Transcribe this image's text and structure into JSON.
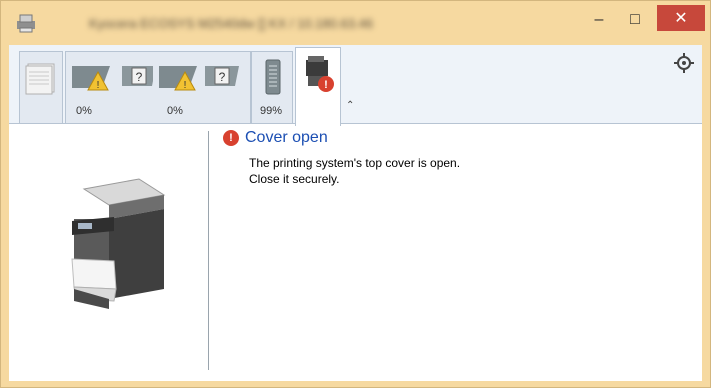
{
  "window": {
    "title": "Kyocera ECOSYS M2540dw [] KX / 10.180.63.46",
    "minimize_label": "–",
    "maximize_label": "□",
    "close_label": "✕"
  },
  "toolbar": {
    "tabs": [
      {
        "icon": "paper-stack-icon"
      },
      {
        "icon": "toner-unknown-icon",
        "percent": "0%"
      },
      {
        "icon": "toner-unknown-icon",
        "percent": "0%"
      },
      {
        "icon": "toner-cartridge-icon",
        "percent": "99%"
      },
      {
        "icon": "printer-error-icon"
      }
    ],
    "collapse_glyph": "⌃"
  },
  "message": {
    "title": "Cover open",
    "lines": [
      "The printing system's top cover is open.",
      "Close it securely."
    ]
  },
  "colors": {
    "frame": "#f6d9a0",
    "close": "#c7483b",
    "title_link": "#1c4fb3",
    "error": "#d8412f"
  }
}
